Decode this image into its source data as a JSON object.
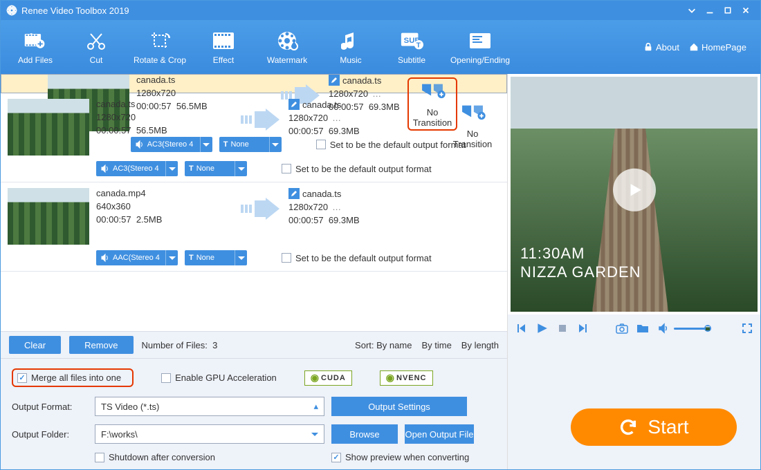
{
  "titlebar": {
    "title": "Renee Video Toolbox 2019"
  },
  "toolbar": {
    "add_files": "Add Files",
    "cut": "Cut",
    "rotate": "Rotate & Crop",
    "effect": "Effect",
    "watermark": "Watermark",
    "music": "Music",
    "subtitle": "Subtitle",
    "opening": "Opening/Ending",
    "about": "About",
    "homepage": "HomePage"
  },
  "files": [
    {
      "src_name": "canada.ts",
      "src_res": "1280x720",
      "src_dur": "00:00:57",
      "src_size": "56.5MB",
      "dst_name": "canada.ts",
      "dst_res": "1280x720",
      "dst_dur": "00:00:57",
      "dst_size": "69.3MB",
      "audio": "AC3(Stereo 4",
      "text": "None",
      "transition": "No Transition",
      "default_label": "Set to be the default output format",
      "highlighted_transition": true,
      "selected": true
    },
    {
      "src_name": "canada.ts",
      "src_res": "1280x720",
      "src_dur": "00:00:57",
      "src_size": "56.5MB",
      "dst_name": "canada.ts",
      "dst_res": "1280x720",
      "dst_dur": "00:00:57",
      "dst_size": "69.3MB",
      "audio": "AC3(Stereo 4",
      "text": "None",
      "transition": "No Transition",
      "default_label": "Set to be the default output format",
      "highlighted_transition": false,
      "selected": false
    },
    {
      "src_name": "canada.mp4",
      "src_res": "640x360",
      "src_dur": "00:00:57",
      "src_size": "2.5MB",
      "dst_name": "canada.ts",
      "dst_res": "1280x720",
      "dst_dur": "00:00:57",
      "dst_size": "69.3MB",
      "audio": "AAC(Stereo 4",
      "text": "None",
      "transition": "",
      "default_label": "Set to be the default output format",
      "highlighted_transition": false,
      "selected": false
    }
  ],
  "listbar": {
    "clear": "Clear",
    "remove": "Remove",
    "count_label": "Number of Files:",
    "count": "3",
    "sort_label": "Sort:",
    "by_name": "By name",
    "by_time": "By time",
    "by_length": "By length"
  },
  "opts": {
    "merge": "Merge all files into one",
    "gpu": "Enable GPU Acceleration",
    "cuda": "CUDA",
    "nvenc": "NVENC",
    "output_format_label": "Output Format:",
    "output_format_value": "TS Video (*.ts)",
    "output_settings": "Output Settings",
    "output_folder_label": "Output Folder:",
    "output_folder_value": "F:\\works\\",
    "browse": "Browse",
    "open_folder": "Open Output File",
    "shutdown": "Shutdown after conversion",
    "preview": "Show preview when converting",
    "start": "Start"
  },
  "preview": {
    "time": "11:30AM",
    "place": "NIZZA GARDEN"
  }
}
